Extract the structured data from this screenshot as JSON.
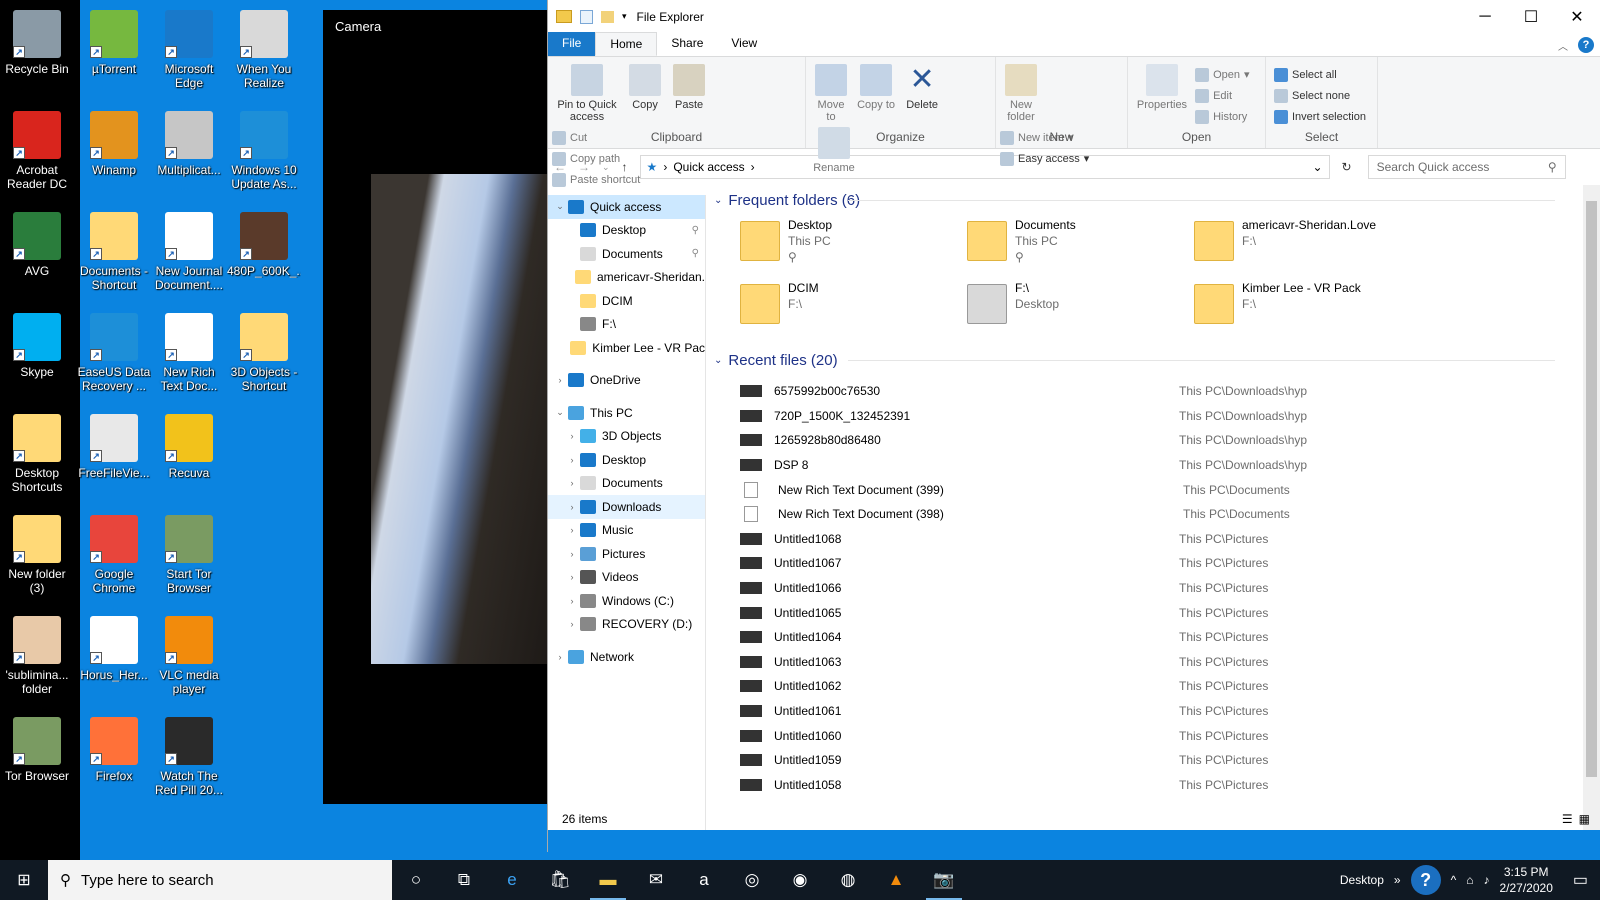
{
  "desktop": {
    "col1": [
      {
        "label": "Recycle Bin",
        "icon": "recycle-bin-icon",
        "color": "#8a9aa6"
      },
      {
        "label": "Acrobat Reader DC",
        "icon": "acrobat-icon",
        "color": "#d9251d"
      },
      {
        "label": "AVG",
        "icon": "avg-icon",
        "color": "#2a7d3c"
      },
      {
        "label": "Skype",
        "icon": "skype-icon",
        "color": "#00aff0"
      },
      {
        "label": "Desktop Shortcuts",
        "icon": "folder-icon",
        "color": "#ffd977"
      },
      {
        "label": "New folder (3)",
        "icon": "folder-icon",
        "color": "#ffd977"
      },
      {
        "label": "'sublimina... folder",
        "icon": "folder-icon",
        "color": "#e8c9a8"
      },
      {
        "label": "Tor Browser",
        "icon": "tor-icon",
        "color": "#7a9b62"
      }
    ],
    "col2": [
      {
        "label": "µTorrent",
        "icon": "utorrent-icon",
        "color": "#76b83f"
      },
      {
        "label": "Winamp",
        "icon": "winamp-icon",
        "color": "#e3931e"
      },
      {
        "label": "Documents - Shortcut",
        "icon": "folder-icon",
        "color": "#ffd977"
      },
      {
        "label": "EaseUS Data Recovery ...",
        "icon": "easeus-icon",
        "color": "#1d8fd8"
      },
      {
        "label": "FreeFileVie...",
        "icon": "freefileviewer-icon",
        "color": "#e8e8e8"
      },
      {
        "label": "Google Chrome",
        "icon": "chrome-icon",
        "color": "#e8453c"
      },
      {
        "label": "Horus_Her...",
        "icon": "pdf-icon",
        "color": "#ffffff"
      },
      {
        "label": "Firefox",
        "icon": "firefox-icon",
        "color": "#ff7139"
      }
    ],
    "col3": [
      {
        "label": "Microsoft Edge",
        "icon": "edge-icon",
        "color": "#1979ca"
      },
      {
        "label": "Multiplicat...",
        "icon": "multiplication-icon",
        "color": "#c6c6c6"
      },
      {
        "label": "New Journal Document....",
        "icon": "document-icon",
        "color": "#ffffff"
      },
      {
        "label": "New Rich Text Doc...",
        "icon": "rtf-document-icon",
        "color": "#ffffff"
      },
      {
        "label": "Recuva",
        "icon": "recuva-icon",
        "color": "#f2c21b"
      },
      {
        "label": "Start Tor Browser",
        "icon": "tor-icon",
        "color": "#7a9b62"
      },
      {
        "label": "VLC media player",
        "icon": "vlc-icon",
        "color": "#f28b0c"
      },
      {
        "label": "Watch The Red Pill 20...",
        "icon": "video-icon",
        "color": "#2a2a2a"
      }
    ],
    "col4": [
      {
        "label": "When You Realize",
        "icon": "gradient-icon",
        "color": "#d9d9d9"
      },
      {
        "label": "Windows 10 Update As...",
        "icon": "windows-update-icon",
        "color": "#1d8fd8"
      },
      {
        "label": "480P_600K_...",
        "icon": "video-icon",
        "color": "#5a3a2a"
      },
      {
        "label": "3D Objects - Shortcut",
        "icon": "folder-icon",
        "color": "#ffd977"
      }
    ]
  },
  "camera": {
    "title": "Camera"
  },
  "explorer": {
    "title": "File Explorer",
    "tabs": [
      "File",
      "Home",
      "Share",
      "View"
    ],
    "ribbon": {
      "clipboard": {
        "name": "Clipboard",
        "pin": "Pin to Quick access",
        "copy": "Copy",
        "paste": "Paste",
        "cut": "Cut",
        "copy_path": "Copy path",
        "paste_shortcut": "Paste shortcut"
      },
      "organize": {
        "name": "Organize",
        "move_to": "Move to",
        "copy_to": "Copy to",
        "delete": "Delete",
        "rename": "Rename"
      },
      "new": {
        "name": "New",
        "new_folder": "New folder",
        "new_item": "New item",
        "easy_access": "Easy access"
      },
      "open": {
        "name": "Open",
        "properties": "Properties",
        "open": "Open",
        "edit": "Edit",
        "history": "History"
      },
      "select": {
        "name": "Select",
        "select_all": "Select all",
        "select_none": "Select none",
        "invert": "Invert selection"
      }
    },
    "address": {
      "path": "Quick access",
      "search_placeholder": "Search Quick access"
    },
    "nav": [
      {
        "label": "Quick access",
        "level": 0,
        "chev": "⌄",
        "icon": "star-icon",
        "color": "#1979ca",
        "state": "sel"
      },
      {
        "label": "Desktop",
        "level": 1,
        "chev": "",
        "icon": "desktop-icon",
        "color": "#1979ca",
        "pin": true
      },
      {
        "label": "Documents",
        "level": 1,
        "chev": "",
        "icon": "documents-icon",
        "color": "#d9d9d9",
        "pin": true
      },
      {
        "label": "americavr-Sheridan.",
        "level": 1,
        "chev": "",
        "icon": "folder-icon",
        "color": "#ffd977"
      },
      {
        "label": "DCIM",
        "level": 1,
        "chev": "",
        "icon": "folder-icon",
        "color": "#ffd977"
      },
      {
        "label": "F:\\",
        "level": 1,
        "chev": "",
        "icon": "drive-icon",
        "color": "#888888"
      },
      {
        "label": "Kimber Lee - VR Pac",
        "level": 1,
        "chev": "",
        "icon": "folder-icon",
        "color": "#ffd977"
      },
      {
        "label": "",
        "level": 0,
        "chev": "",
        "icon": "",
        "color": ""
      },
      {
        "label": "OneDrive",
        "level": 0,
        "chev": "›",
        "icon": "onedrive-icon",
        "color": "#1979ca"
      },
      {
        "label": "",
        "level": 0,
        "chev": "",
        "icon": "",
        "color": ""
      },
      {
        "label": "This PC",
        "level": 0,
        "chev": "⌄",
        "icon": "this-pc-icon",
        "color": "#4aa3df"
      },
      {
        "label": "3D Objects",
        "level": 1,
        "chev": "›",
        "icon": "3d-objects-icon",
        "color": "#43b0e8"
      },
      {
        "label": "Desktop",
        "level": 1,
        "chev": "›",
        "icon": "desktop-icon",
        "color": "#1979ca"
      },
      {
        "label": "Documents",
        "level": 1,
        "chev": "›",
        "icon": "documents-icon",
        "color": "#d9d9d9"
      },
      {
        "label": "Downloads",
        "level": 1,
        "chev": "›",
        "icon": "downloads-icon",
        "color": "#1979ca",
        "state": "hl"
      },
      {
        "label": "Music",
        "level": 1,
        "chev": "›",
        "icon": "music-icon",
        "color": "#1979ca"
      },
      {
        "label": "Pictures",
        "level": 1,
        "chev": "›",
        "icon": "pictures-icon",
        "color": "#5a9fd6"
      },
      {
        "label": "Videos",
        "level": 1,
        "chev": "›",
        "icon": "videos-icon",
        "color": "#555555"
      },
      {
        "label": "Windows (C:)",
        "level": 1,
        "chev": "›",
        "icon": "drive-icon",
        "color": "#888888"
      },
      {
        "label": "RECOVERY (D:)",
        "level": 1,
        "chev": "›",
        "icon": "drive-icon",
        "color": "#888888"
      },
      {
        "label": "",
        "level": 0,
        "chev": "",
        "icon": "",
        "color": ""
      },
      {
        "label": "Network",
        "level": 0,
        "chev": "›",
        "icon": "network-icon",
        "color": "#4aa3df"
      }
    ],
    "frequent": {
      "heading": "Frequent folders (6)",
      "items": [
        {
          "name": "Desktop",
          "sub": "This PC",
          "pinned": true,
          "icon": "desktop-folder-icon"
        },
        {
          "name": "Documents",
          "sub": "This PC",
          "pinned": true,
          "icon": "documents-folder-icon"
        },
        {
          "name": "americavr-Sheridan.Love",
          "sub": "F:\\",
          "pinned": false,
          "icon": "folder-icon"
        },
        {
          "name": "DCIM",
          "sub": "F:\\",
          "pinned": false,
          "icon": "folder-icon"
        },
        {
          "name": "F:\\",
          "sub": "Desktop",
          "pinned": false,
          "icon": "unknown-drive-icon"
        },
        {
          "name": "Kimber Lee - VR Pack",
          "sub": "F:\\",
          "pinned": false,
          "icon": "folder-icon"
        }
      ]
    },
    "recent": {
      "heading": "Recent files (20)",
      "items": [
        {
          "name": "6575992b00c76530",
          "path": "This PC\\Downloads\\hyp"
        },
        {
          "name": "720P_1500K_132452391",
          "path": "This PC\\Downloads\\hyp"
        },
        {
          "name": "1265928b80d86480",
          "path": "This PC\\Downloads\\hyp"
        },
        {
          "name": "DSP 8",
          "path": "This PC\\Downloads\\hyp"
        },
        {
          "name": "New Rich Text Document (399)",
          "path": "This PC\\Documents"
        },
        {
          "name": "New Rich Text Document (398)",
          "path": "This PC\\Documents"
        },
        {
          "name": "Untitled1068",
          "path": "This PC\\Pictures"
        },
        {
          "name": "Untitled1067",
          "path": "This PC\\Pictures"
        },
        {
          "name": "Untitled1066",
          "path": "This PC\\Pictures"
        },
        {
          "name": "Untitled1065",
          "path": "This PC\\Pictures"
        },
        {
          "name": "Untitled1064",
          "path": "This PC\\Pictures"
        },
        {
          "name": "Untitled1063",
          "path": "This PC\\Pictures"
        },
        {
          "name": "Untitled1062",
          "path": "This PC\\Pictures"
        },
        {
          "name": "Untitled1061",
          "path": "This PC\\Pictures"
        },
        {
          "name": "Untitled1060",
          "path": "This PC\\Pictures"
        },
        {
          "name": "Untitled1059",
          "path": "This PC\\Pictures"
        },
        {
          "name": "Untitled1058",
          "path": "This PC\\Pictures"
        }
      ]
    },
    "status": "26 items"
  },
  "taskbar": {
    "search_placeholder": "Type here to search",
    "apps": [
      {
        "icon": "task-view-circle-icon"
      },
      {
        "icon": "task-view-icon"
      },
      {
        "icon": "edge-icon"
      },
      {
        "icon": "store-icon"
      },
      {
        "icon": "file-explorer-icon",
        "active": true
      },
      {
        "icon": "mail-icon"
      },
      {
        "icon": "amazon-icon"
      },
      {
        "icon": "tripadvisor-icon"
      },
      {
        "icon": "camera-app-icon"
      },
      {
        "icon": "color-app-icon"
      },
      {
        "icon": "vlc-icon"
      },
      {
        "icon": "camera-icon",
        "active": true
      }
    ],
    "desktop_label": "Desktop",
    "time": "3:15 PM",
    "date": "2/27/2020"
  }
}
